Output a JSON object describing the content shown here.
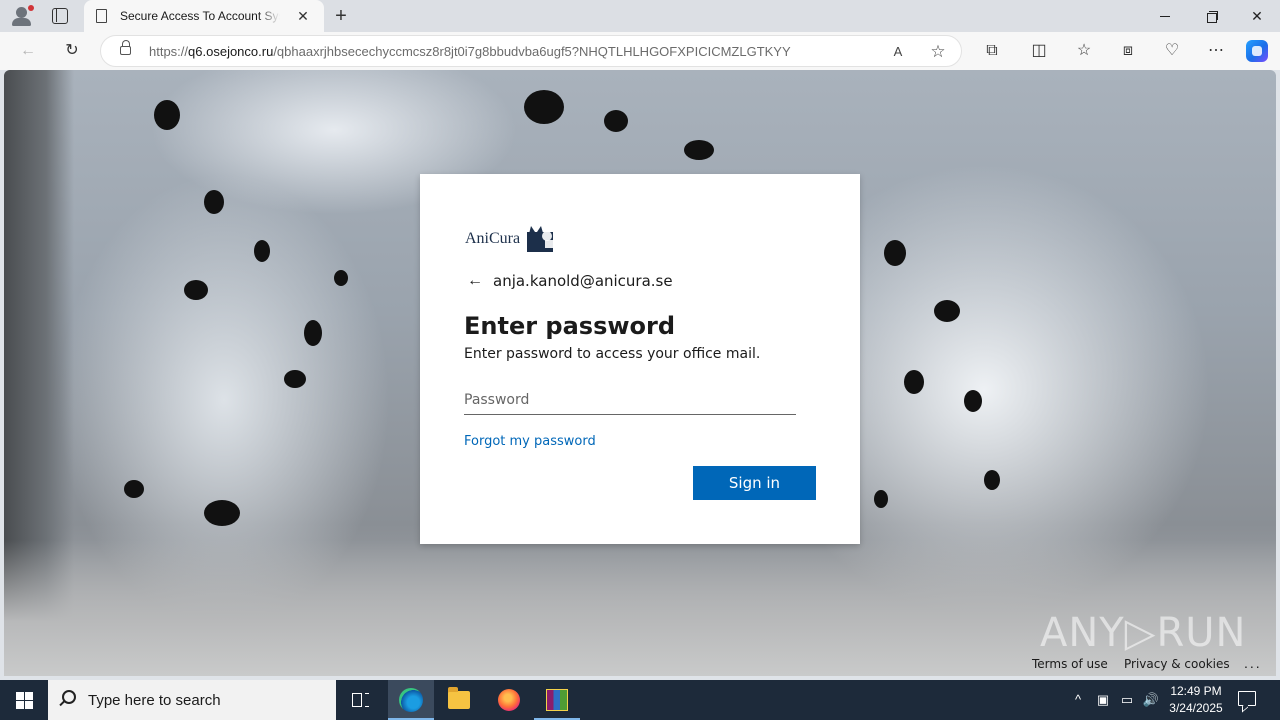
{
  "browser": {
    "tab": {
      "title": "Secure Access To Account System",
      "close_glyph": "✕"
    },
    "new_tab_glyph": "+",
    "window": {
      "min": "",
      "max": "",
      "close": "✕"
    },
    "toolbar": {
      "back_glyph": "←",
      "refresh_glyph": "↻",
      "read_aloud_glyph": "A",
      "favorite_glyph": "☆",
      "extensions_glyph": "⧉",
      "split_glyph": "◫",
      "favorites_glyph": "☆",
      "collections_glyph": "⧈",
      "performance_glyph": "♡",
      "more_glyph": "⋯"
    },
    "address": {
      "scheme": "https://",
      "domain": "q6.osejonco.ru",
      "path": "/qbhaaxrjhbsecechyccmcsz8r8jt0i7g8bbudvba6ugf5?NHQTLHLHGOFXPICICMZLGTKYY"
    }
  },
  "login": {
    "logo_text": "AniCura",
    "back_glyph": "←",
    "identity": "anja.kanold@anicura.se",
    "heading": "Enter password",
    "subheading": "Enter password to access your office mail.",
    "password_placeholder": "Password",
    "forgot_link": "Forgot my password",
    "signin_button": "Sign in"
  },
  "footer": {
    "terms": "Terms of use",
    "privacy": "Privacy & cookies",
    "more": "..."
  },
  "watermark": "ANY▷RUN",
  "taskbar": {
    "search_placeholder": "Type here to search",
    "tray": {
      "chevron": "^",
      "device": "▣",
      "network": "▭",
      "volume": "🔊"
    },
    "clock_time": "12:49 PM",
    "clock_date": "3/24/2025"
  },
  "colors": {
    "accent": "#0067b8",
    "taskbar": "#1d2a3a",
    "link": "#0067b8"
  }
}
